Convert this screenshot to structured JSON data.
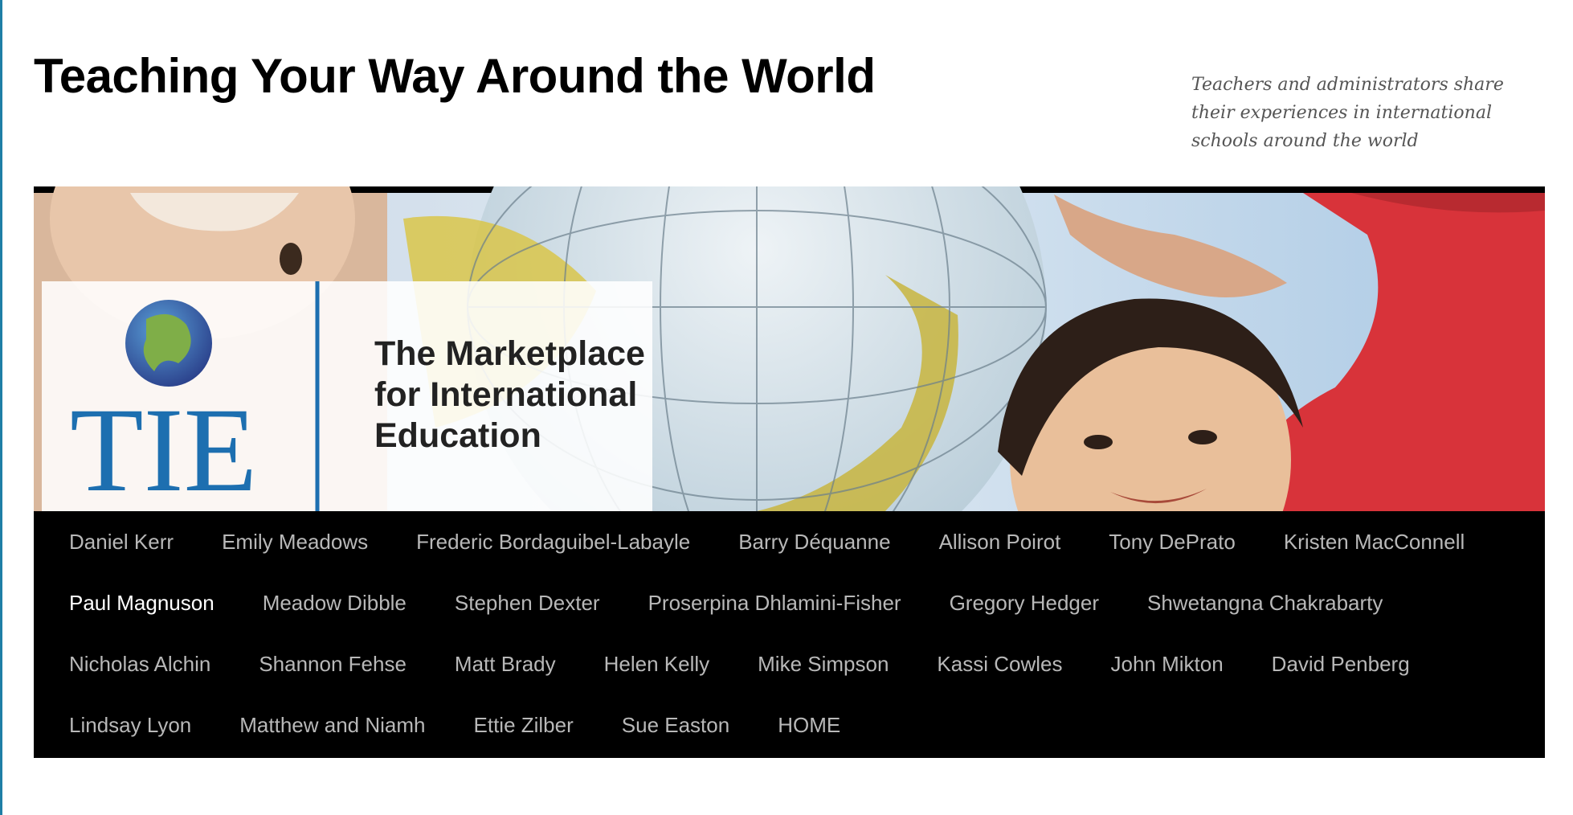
{
  "site": {
    "title": "Teaching Your Way Around the World",
    "tagline": "Teachers and administrators share their experiences in international schools around the world"
  },
  "banner": {
    "logo_text": "TIE",
    "logo_line1": "The Marketplace",
    "logo_line2": "for International",
    "logo_line3": "Education"
  },
  "nav": {
    "current": "Paul Magnuson",
    "items": [
      "Daniel Kerr",
      "Emily Meadows",
      "Frederic Bordaguibel-Labayle",
      "Barry Déquanne",
      "Allison Poirot",
      "Tony DePrato",
      "Kristen MacConnell",
      "Paul Magnuson",
      "Meadow Dibble",
      "Stephen Dexter",
      "Proserpina Dhlamini-Fisher",
      "Gregory Hedger",
      "Shwetangna Chakrabarty",
      "Nicholas Alchin",
      "Shannon Fehse",
      "Matt Brady",
      "Helen Kelly",
      "Mike Simpson",
      "Kassi Cowles",
      "John Mikton",
      "David Penberg",
      "Lindsay Lyon",
      "Matthew and Niamh",
      "Ettie Zilber",
      "Sue Easton",
      "HOME"
    ]
  },
  "colors": {
    "accent_edge": "#1f7fa6",
    "logo_blue": "#1d6fb0",
    "nav_bg": "#000000",
    "nav_text": "#b8b8b8",
    "nav_current": "#ffffff"
  }
}
